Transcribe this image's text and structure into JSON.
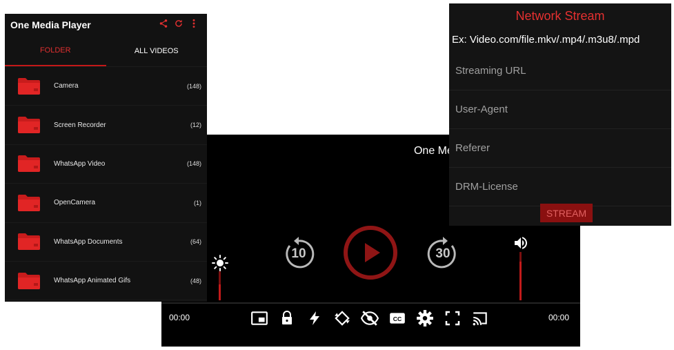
{
  "folder_panel": {
    "title": "One Media Player",
    "tabs": [
      {
        "label": "FOLDER",
        "active": true
      },
      {
        "label": "ALL VIDEOS",
        "active": false
      }
    ],
    "folders": [
      {
        "name": "Camera",
        "count": "(148)"
      },
      {
        "name": "Screen Recorder",
        "count": "(12)"
      },
      {
        "name": "WhatsApp Video",
        "count": "(148)"
      },
      {
        "name": "OpenCamera",
        "count": "(1)"
      },
      {
        "name": "WhatsApp Documents",
        "count": "(64)"
      },
      {
        "name": "WhatsApp Animated Gifs",
        "count": "(48)"
      }
    ],
    "icons": [
      "share-icon",
      "refresh-icon",
      "more-vert-icon",
      "folder-icon"
    ]
  },
  "player": {
    "title": "One Media Player",
    "rewind_seconds": "10",
    "forward_seconds": "30",
    "current_time": "00:00",
    "total_time": "00:00",
    "brightness_level": 0.55,
    "volume_level": 0.8,
    "bottom_icons": [
      "pip-icon",
      "lock-icon",
      "flash-icon",
      "rotate-icon",
      "eye-off-icon",
      "cc-icon",
      "settings-icon",
      "fullscreen-icon",
      "cast-icon"
    ]
  },
  "stream_panel": {
    "title": "Network Stream",
    "example": "Ex: Video.com/file.mkv/.mp4/.m3u8/.mpd",
    "fields": [
      {
        "placeholder": "Streaming URL"
      },
      {
        "placeholder": "User-Agent"
      },
      {
        "placeholder": "Referer"
      },
      {
        "placeholder": "DRM-License"
      }
    ],
    "button_label": "STREAM"
  },
  "colors": {
    "accent": "#c41818",
    "panel_bg": "#121212",
    "player_bg": "#000000"
  }
}
